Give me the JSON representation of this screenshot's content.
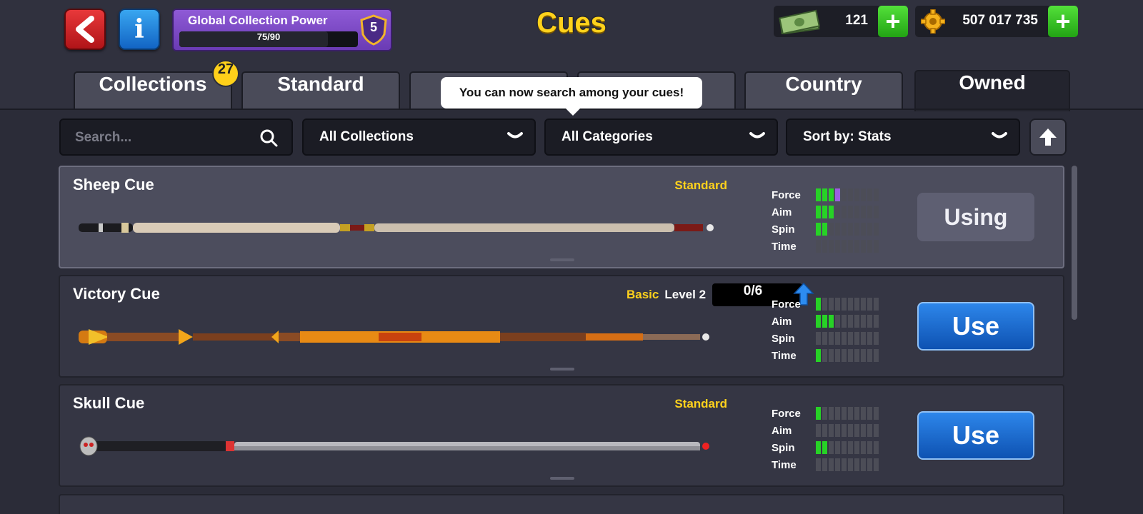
{
  "header": {
    "title": "Cues",
    "power": {
      "label": "Global Collection Power",
      "value_text": "75/90",
      "progress": 0.833,
      "level": "5"
    },
    "cash": {
      "amount": "121"
    },
    "coins": {
      "amount": "507 017 735"
    }
  },
  "tabs": [
    {
      "label": "Collections",
      "badge": "27"
    },
    {
      "label": "Standard"
    },
    {
      "label": ""
    },
    {
      "label": ""
    },
    {
      "label": "Country"
    },
    {
      "label": "Owned",
      "active": true
    }
  ],
  "tooltip": "You can now search among your cues!",
  "filters": {
    "search_placeholder": "Search...",
    "collection": "All Collections",
    "category": "All Categories",
    "sort": "Sort by: Stats"
  },
  "stat_labels": [
    "Force",
    "Aim",
    "Spin",
    "Time"
  ],
  "cues": [
    {
      "name": "Sheep Cue",
      "category": "Standard",
      "button": "Using",
      "stats": {
        "force": 3,
        "force_upgrade": 1,
        "aim": 3,
        "spin": 2,
        "time": 0
      }
    },
    {
      "name": "Victory Cue",
      "category": "Basic",
      "level": "Level 2",
      "progress": "0/6",
      "button": "Use",
      "stats": {
        "force": 1,
        "aim": 3,
        "spin": 0,
        "time": 1
      }
    },
    {
      "name": "Skull Cue",
      "category": "Standard",
      "button": "Use",
      "stats": {
        "force": 1,
        "aim": 0,
        "spin": 2,
        "time": 0
      }
    }
  ],
  "colors": {
    "accent_yellow": "#ffd21c",
    "stat_green": "#27d226",
    "button_blue": "#1a6ad0"
  }
}
